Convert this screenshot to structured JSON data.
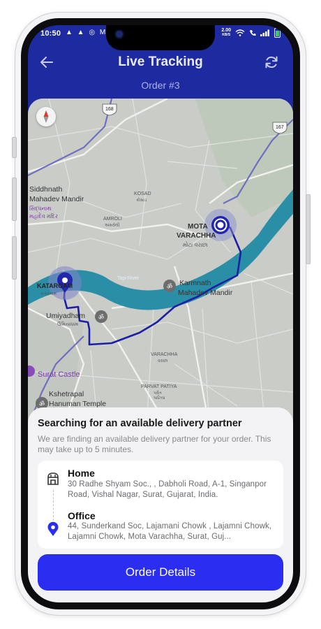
{
  "status_bar": {
    "time": "10:50",
    "left_icons": "▲ ▲ ◎ M",
    "net_speed_value": "2.00",
    "net_speed_unit": "KB/S"
  },
  "header": {
    "title": "Live Tracking",
    "subtitle": "Order #3"
  },
  "map": {
    "labels": {
      "siddhnath": "Siddhnath",
      "mahadev_mandir": "Mahadev Mandir",
      "siddhnath_local": "સિદ્ધનાથ",
      "mahadev_local": "મહાદેવ મંદિર",
      "kosad": "KOSAD",
      "kosad_local": "કોસાડ",
      "amroli": "AMROLI",
      "amroli_local": "અમરોલી",
      "mota": "MOTA",
      "varachha": "VARACHHA",
      "varachha_local": "મોટા વરાછા",
      "katargam": "KATARGAM",
      "katargam_local": "કતારગામ",
      "karmnath": "Karmnath",
      "karmnath_mandir": "Mahadev Mandir",
      "umiyadham": "Umiyadham",
      "umiyadham_local": "ઉમિયાધામ",
      "varachha2": "VARACHHA",
      "varachha2_local": "વરાછા",
      "surat_castle": "Surat Castle",
      "parvat_patiya": "PARVAT PATIYA",
      "parvat_local": "પર્વત",
      "patiya_local": "પાટિયા",
      "kshetrapal": "Kshetrapal",
      "hanuman_temple": "Hanuman Temple",
      "river": "Tapi River",
      "route_168": "168",
      "route_167": "167"
    }
  },
  "sheet": {
    "title": "Searching for an available delivery partner",
    "description": "We are finding an available delivery partner for your order. This may take up to 5 minutes.",
    "home_label": "Home",
    "home_address": "30 Radhe Shyam Soc., , Dabholi Road, A-1, Singanpor Road, Vishal Nagar, Surat, Gujarat, India.",
    "office_label": "Office",
    "office_address": "44, Sunderkand Soc, Lajamani Chowk , Lajamni Chowk, Lajamni Chowk, Mota Varachha, Surat, Guj...",
    "button_label": "Order Details"
  },
  "colors": {
    "primary": "#2b2ef0",
    "header_bg": "#1e2aa0",
    "route": "#1c1fa3",
    "river": "#2a8fa6"
  }
}
